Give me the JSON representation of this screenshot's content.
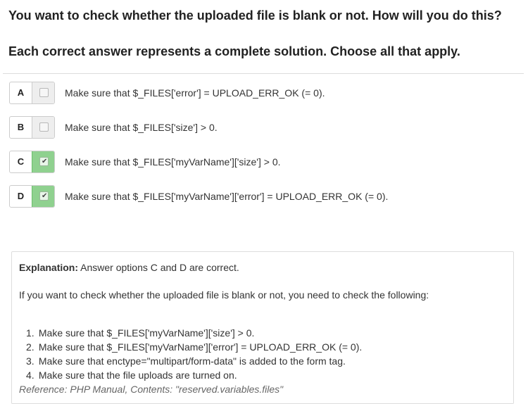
{
  "question": {
    "text": "You want to check whether the uploaded file is blank or not. How will you do this?",
    "instruction": "Each correct answer represents a complete solution. Choose all that apply."
  },
  "options": [
    {
      "letter": "A",
      "text": "Make sure that $_FILES['error'] = UPLOAD_ERR_OK (= 0).",
      "checked": false
    },
    {
      "letter": "B",
      "text": "Make sure that $_FILES['size'] > 0.",
      "checked": false
    },
    {
      "letter": "C",
      "text": "Make sure that $_FILES['myVarName']['size'] > 0.",
      "checked": true
    },
    {
      "letter": "D",
      "text": "Make sure that $_FILES['myVarName']['error'] = UPLOAD_ERR_OK (= 0).",
      "checked": true
    }
  ],
  "explanation": {
    "label": "Explanation:",
    "summary": " Answer options C and D are correct.",
    "intro": "If you want to check whether the uploaded file is blank or not, you need to check the following:",
    "steps": [
      {
        "num": "1.",
        "text": "Make sure that $_FILES['myVarName']['size'] > 0."
      },
      {
        "num": "2.",
        "text": "Make sure that $_FILES['myVarName']['error'] = UPLOAD_ERR_OK (= 0)."
      },
      {
        "num": "3.",
        "text": "Make sure that enctype=\"multipart/form-data\" is added to the form tag."
      },
      {
        "num": "4.",
        "text": "Make sure that the file uploads are turned on."
      }
    ],
    "reference": "Reference: PHP Manual, Contents: \"reserved.variables.files\""
  },
  "colors": {
    "checked_bg": "#8fd18f",
    "unchecked_bg": "#eeeeee"
  },
  "icons": {
    "check": "checkmark-icon"
  }
}
